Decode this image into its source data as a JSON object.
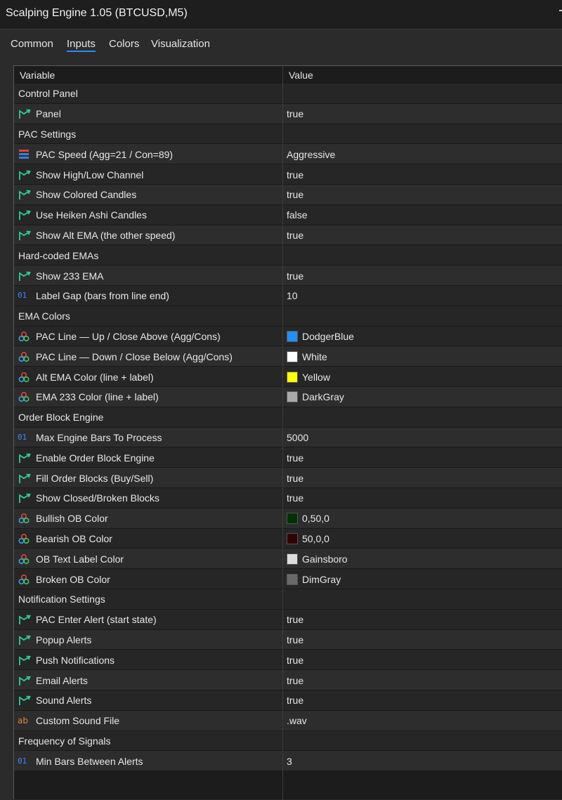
{
  "window": {
    "title": "Scalping Engine 1.05 (BTCUSD,M5)"
  },
  "tabs": [
    {
      "label": "Common",
      "active": false
    },
    {
      "label": "Inputs",
      "active": true
    },
    {
      "label": "Colors",
      "active": false
    },
    {
      "label": "Visualization",
      "active": false
    }
  ],
  "table": {
    "col_variable": "Variable",
    "col_value": "Value",
    "rows": [
      {
        "kind": "section",
        "label": "Control Panel"
      },
      {
        "kind": "bool",
        "label": "Panel",
        "value": "true"
      },
      {
        "kind": "section",
        "label": "PAC Settings"
      },
      {
        "kind": "enum",
        "label": "PAC Speed (Agg=21 / Con=89)",
        "value": "Aggressive"
      },
      {
        "kind": "bool",
        "label": "Show High/Low Channel",
        "value": "true"
      },
      {
        "kind": "bool",
        "label": "Show Colored Candles",
        "value": "true"
      },
      {
        "kind": "bool",
        "label": "Use Heiken Ashi Candles",
        "value": "false"
      },
      {
        "kind": "bool",
        "label": "Show Alt EMA (the other speed)",
        "value": "true"
      },
      {
        "kind": "section",
        "label": "Hard-coded EMAs"
      },
      {
        "kind": "bool",
        "label": "Show 233 EMA",
        "value": "true"
      },
      {
        "kind": "int",
        "label": "Label Gap (bars from line end)",
        "value": "10"
      },
      {
        "kind": "section",
        "label": "EMA Colors"
      },
      {
        "kind": "color",
        "label": "PAC Line — Up / Close Above (Agg/Cons)",
        "value": "DodgerBlue",
        "swatch": "#1e90ff"
      },
      {
        "kind": "color",
        "label": "PAC Line — Down / Close Below (Agg/Cons)",
        "value": "White",
        "swatch": "#ffffff"
      },
      {
        "kind": "color",
        "label": "Alt EMA Color (line + label)",
        "value": "Yellow",
        "swatch": "#ffff00"
      },
      {
        "kind": "color",
        "label": "EMA 233 Color (line + label)",
        "value": "DarkGray",
        "swatch": "#a9a9a9"
      },
      {
        "kind": "section",
        "label": "Order Block Engine"
      },
      {
        "kind": "int",
        "label": "Max Engine Bars To Process",
        "value": "5000"
      },
      {
        "kind": "bool",
        "label": "Enable Order Block Engine",
        "value": "true"
      },
      {
        "kind": "bool",
        "label": "Fill Order Blocks (Buy/Sell)",
        "value": "true"
      },
      {
        "kind": "bool",
        "label": "Show Closed/Broken Blocks",
        "value": "true"
      },
      {
        "kind": "color",
        "label": "Bullish OB Color",
        "value": "0,50,0",
        "swatch": "#003200"
      },
      {
        "kind": "color",
        "label": "Bearish OB Color",
        "value": "50,0,0",
        "swatch": "#320000"
      },
      {
        "kind": "color",
        "label": "OB Text Label Color",
        "value": "Gainsboro",
        "swatch": "#dcdcdc"
      },
      {
        "kind": "color",
        "label": "Broken OB Color",
        "value": "DimGray",
        "swatch": "#696969"
      },
      {
        "kind": "section",
        "label": "Notification Settings"
      },
      {
        "kind": "bool",
        "label": "PAC Enter Alert (start state)",
        "value": "true"
      },
      {
        "kind": "bool",
        "label": "Popup Alerts",
        "value": "true"
      },
      {
        "kind": "bool",
        "label": "Push Notifications",
        "value": "true"
      },
      {
        "kind": "bool",
        "label": "Email Alerts",
        "value": "true"
      },
      {
        "kind": "bool",
        "label": "Sound Alerts",
        "value": "true"
      },
      {
        "kind": "string",
        "label": "Custom Sound File",
        "value": ".wav"
      },
      {
        "kind": "section",
        "label": "Frequency of Signals"
      },
      {
        "kind": "int",
        "label": "Min Bars Between Alerts",
        "value": "3"
      }
    ]
  },
  "icons": {
    "bool": "bool-arrow-icon",
    "enum": "enum-list-icon",
    "int": "integer-icon",
    "color": "color-palette-icon",
    "string": "string-icon"
  },
  "icon_glyphs": {
    "int": "01",
    "string": "ab"
  },
  "colors": {
    "accent": "#2d8cf0",
    "bool_icon": "#2ecc9a",
    "int_icon": "#2f8cff",
    "string_icon": "#d7893a"
  }
}
